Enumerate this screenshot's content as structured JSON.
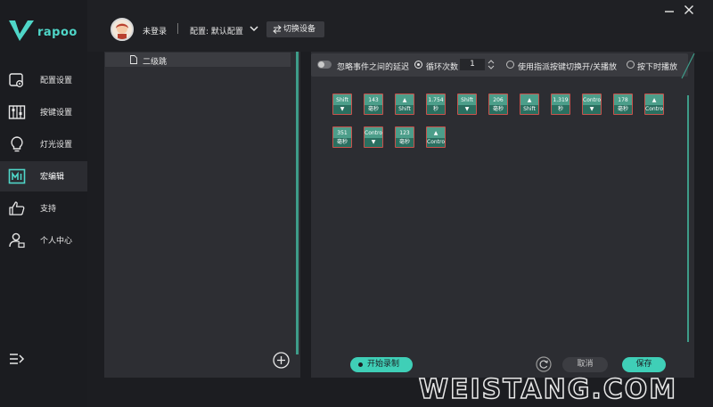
{
  "brand": {
    "name": "rapoo",
    "accent": "#4fd6c8"
  },
  "sidebar": {
    "items": [
      {
        "label": "配置设置",
        "icon": "profile-settings-icon"
      },
      {
        "label": "按键设置",
        "icon": "key-settings-icon"
      },
      {
        "label": "灯光设置",
        "icon": "light-bulb-icon"
      },
      {
        "label": "宏编辑",
        "icon": "macro-edit-icon",
        "active": true
      },
      {
        "label": "支持",
        "icon": "thumbs-up-icon"
      },
      {
        "label": "个人中心",
        "icon": "user-center-icon"
      }
    ],
    "collapse_icon": "collapse-menu-icon"
  },
  "header": {
    "login_status": "未登录",
    "config_label": "配置: 默认配置",
    "switch_device": "切换设备"
  },
  "macro_list": {
    "items": [
      {
        "label": "二级跳"
      }
    ]
  },
  "options": {
    "ignore_delay": "忽略事件之间的延迟",
    "loop_count_label": "循环次数",
    "loop_count_value": "1",
    "toggle_mode": "使用指派按键切换开/关播放",
    "hold_mode": "按下时播放"
  },
  "events": [
    {
      "top": "Shift",
      "bottom": "▼"
    },
    {
      "top": "143",
      "bottom": "毫秒"
    },
    {
      "top": "▲",
      "bottom": "Shift"
    },
    {
      "top": "1.754",
      "bottom": "秒"
    },
    {
      "top": "Shift",
      "bottom": "▼"
    },
    {
      "top": "206",
      "bottom": "毫秒"
    },
    {
      "top": "▲",
      "bottom": "Shift"
    },
    {
      "top": "1.319",
      "bottom": "秒"
    },
    {
      "top": "Control",
      "bottom": "▼"
    },
    {
      "top": "178",
      "bottom": "毫秒"
    },
    {
      "top": "▲",
      "bottom": "Control"
    },
    {
      "top": "351",
      "bottom": "毫秒"
    },
    {
      "top": "Control",
      "bottom": "▼"
    },
    {
      "top": "123",
      "bottom": "毫秒"
    },
    {
      "top": "▲",
      "bottom": "Control"
    }
  ],
  "footer": {
    "record": "开始录制",
    "cancel": "取消",
    "save": "保存"
  },
  "watermark": "WEISTANG.COM"
}
